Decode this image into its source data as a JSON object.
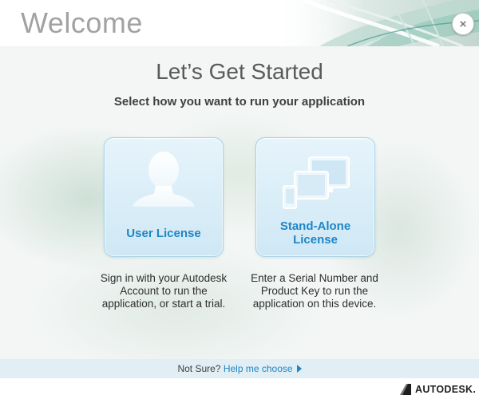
{
  "header": {
    "title": "Welcome",
    "close_symbol": "×"
  },
  "main": {
    "heading": "Let’s Get Started",
    "subheading": "Select how you want to run your application",
    "options": [
      {
        "label": "User License",
        "description": "Sign in with your Autodesk Account to run the application, or start a trial.",
        "icon": "person-silhouette-icon"
      },
      {
        "label": "Stand-Alone License",
        "description": "Enter a Serial Number and Product Key to run the application on this device.",
        "icon": "devices-icon"
      }
    ]
  },
  "footer": {
    "prompt": "Not Sure?",
    "help_link": "Help me choose"
  },
  "brand": {
    "name": "AUTODESK."
  },
  "colors": {
    "accent_blue": "#1f86c6",
    "card_border": "#a9d2e6",
    "card_fill": "#dcefF8",
    "title_gray": "#a2a2a2",
    "footer_bar": "#e1eef4"
  }
}
